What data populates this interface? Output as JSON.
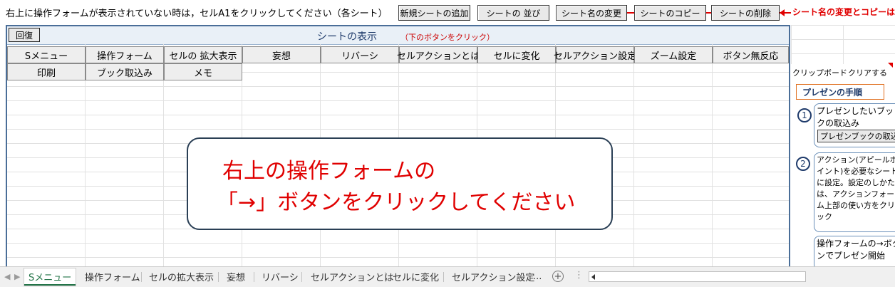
{
  "top": {
    "instruction": "右上に操作フォームが表示されていない時は，セルA1をクリックしてください（各シート）",
    "buttons": [
      "新規シートの追加",
      "シートの 並び",
      "シート名の変更",
      "シートのコピー",
      "シートの削除"
    ],
    "warning": "シート名の変更とコピーは必"
  },
  "frame": {
    "restore": "回復",
    "title": "シートの表示",
    "hint": "（下のボタンをクリック）",
    "row1": [
      "Sメニュー",
      "操作フォーム",
      "セルの 拡大表示",
      "妄想",
      "リバーシ",
      "セルアクションとは",
      "セルに変化",
      "セルアクション設定",
      "ズーム設定",
      "ボタン無反応"
    ],
    "row2": [
      "印刷",
      "ブック取込み",
      "メモ"
    ]
  },
  "callout": {
    "line1": "右上の操作フォームの",
    "line2": "「→」ボタンをクリックしてください"
  },
  "right": {
    "clipboard": "クリップボード",
    "clear": "クリアする",
    "presentation_title": "プレゼンの手順",
    "step1_num": "1",
    "step1_text": "プレゼンしたいブックの取込み",
    "step1_button": "プレゼンブックの取込",
    "step2_num": "2",
    "step2_text": "アクション(アピールポイント)を必要なシートに設定。設定のしかたは、アクションフォーム上部の使い方をクリック",
    "step3_text": "操作フォームの→ボタンでプレゼン開始"
  },
  "tabs": {
    "items": [
      "Sメニュー",
      "操作フォーム",
      "セルの拡大表示",
      "妄想",
      "リバーシ",
      "セルアクションとは",
      "セルに変化",
      "セルアクション設定"
    ],
    "active_index": 0,
    "more": "...",
    "add": "+"
  }
}
